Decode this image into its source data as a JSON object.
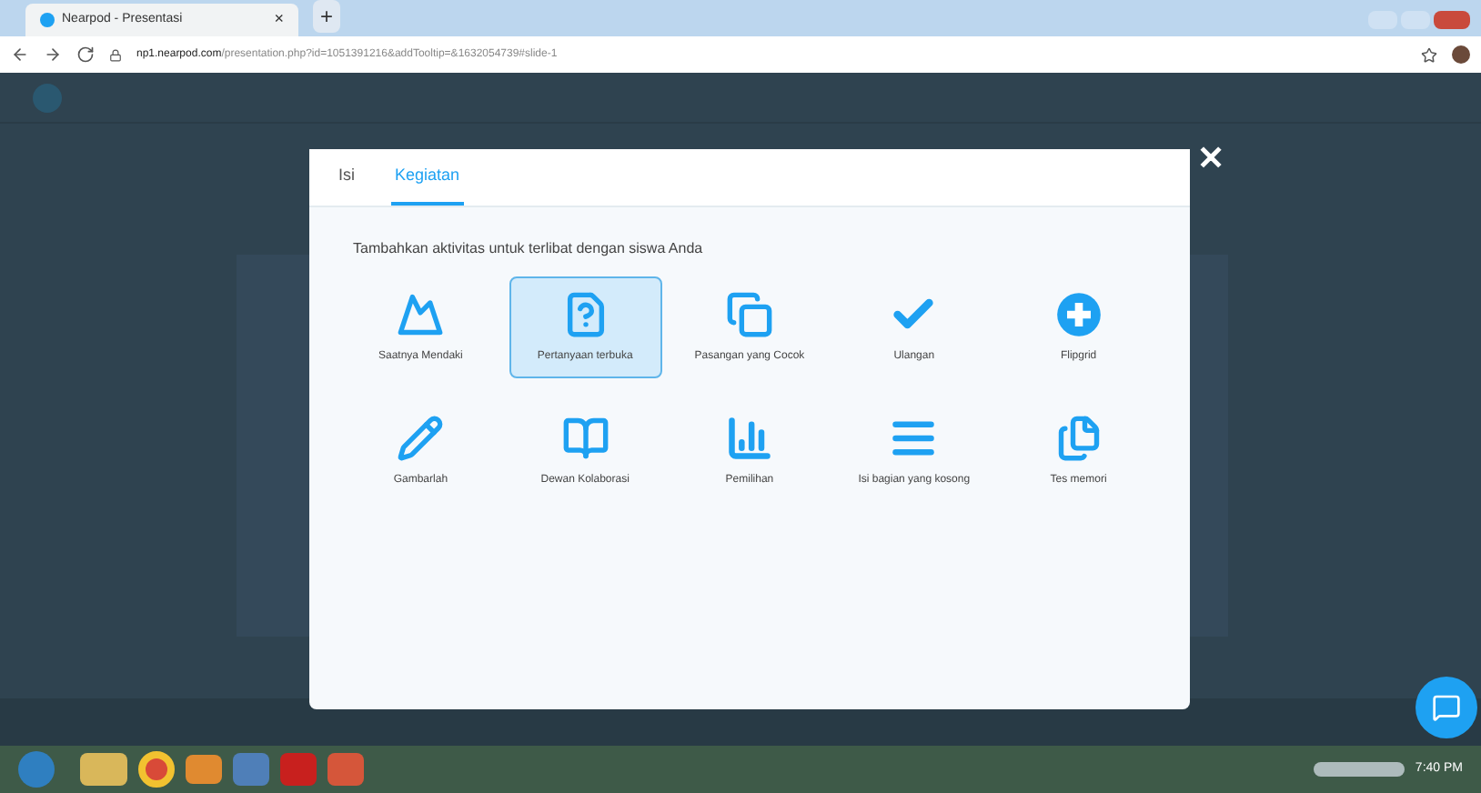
{
  "browser": {
    "tab_title": "Nearpod - Presentasi",
    "tab_close": "×",
    "new_tab": "+",
    "url_host": "np1.nearpod.com",
    "url_path": "/presentation.php?id=1051391216&addTooltip=&1632054739#slide-1"
  },
  "modal": {
    "tabs": [
      {
        "label": "Isi",
        "selected": false
      },
      {
        "label": "Kegiatan",
        "selected": true
      }
    ],
    "close": "✕",
    "heading": "Tambahkan aktivitas untuk terlibat dengan siswa Anda",
    "activities": [
      {
        "kind": "climb",
        "label": "Saatnya Mendaki",
        "selected": false
      },
      {
        "kind": "question",
        "label": "Pertanyaan terbuka",
        "selected": true
      },
      {
        "kind": "matching",
        "label": "Pasangan yang Cocok",
        "selected": false
      },
      {
        "kind": "quiz",
        "label": "Ulangan",
        "selected": false
      },
      {
        "kind": "flipgrid",
        "label": "Flipgrid",
        "selected": false
      },
      {
        "kind": "draw",
        "label": "Gambarlah",
        "selected": false
      },
      {
        "kind": "board",
        "label": "Dewan Kolaborasi",
        "selected": false
      },
      {
        "kind": "poll",
        "label": "Pemilihan",
        "selected": false
      },
      {
        "kind": "blanks",
        "label": "Isi bagian yang kosong",
        "selected": false
      },
      {
        "kind": "memory",
        "label": "Tes memori",
        "selected": false
      }
    ]
  },
  "taskbar": {
    "clock": "7:40 PM"
  }
}
